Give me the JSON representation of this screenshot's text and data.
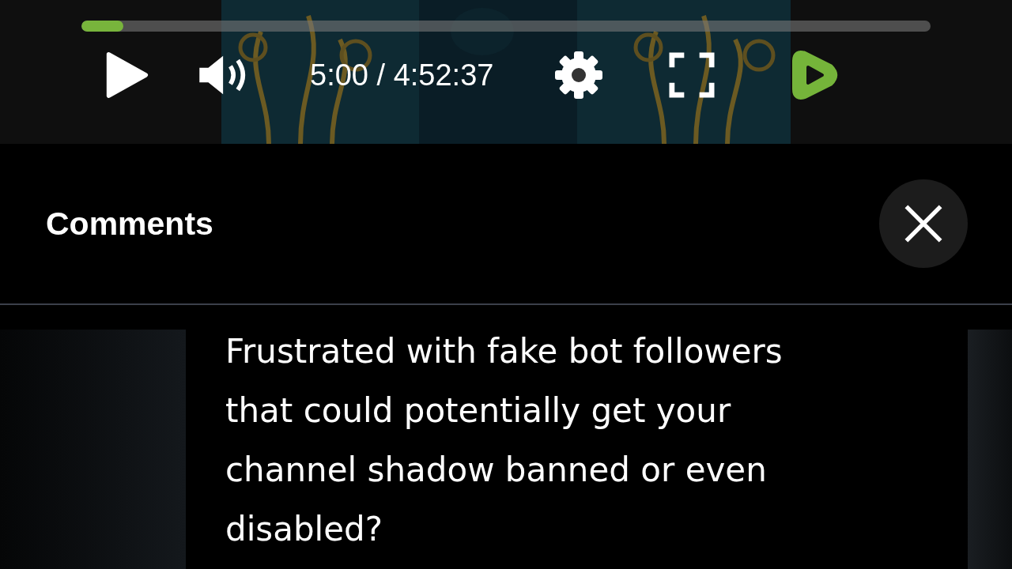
{
  "player": {
    "progress": {
      "level": 0.049
    },
    "time": "5:00 / 4:52:37"
  },
  "comments": {
    "title": "Comments",
    "items": [
      {
        "text": "Frustrated with fake bot followers that could potentially get your channel shadow banned or even disabled?"
      }
    ]
  }
}
